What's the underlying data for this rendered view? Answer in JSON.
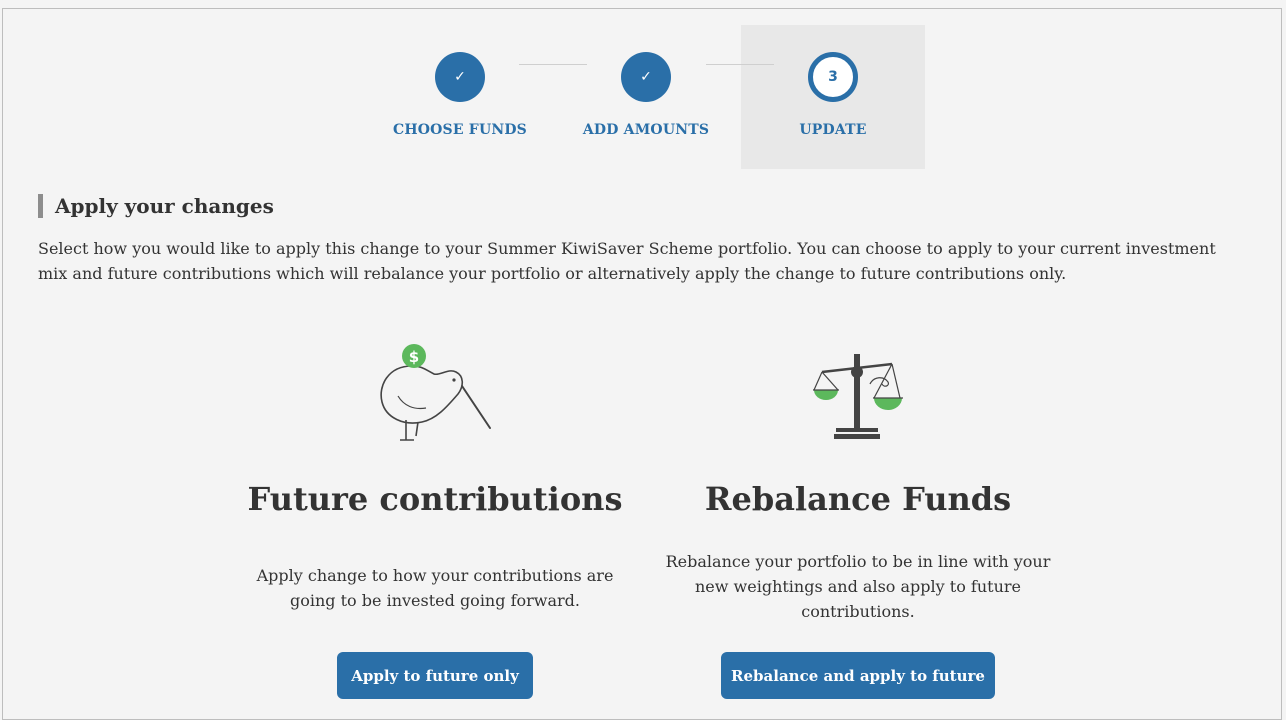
{
  "stepper": {
    "steps": [
      {
        "label": "CHOOSE FUNDS",
        "mark": "✓",
        "state": "complete"
      },
      {
        "label": "ADD AMOUNTS",
        "mark": "✓",
        "state": "complete"
      },
      {
        "label": "UPDATE",
        "mark": "3",
        "state": "current"
      }
    ]
  },
  "section": {
    "title": "Apply your changes",
    "intro": "Select how you would like to apply this change to your Summer KiwiSaver Scheme portfolio. You can choose to apply to your current investment mix and future contributions which will rebalance your portfolio or alternatively apply the change to future contributions only."
  },
  "options": {
    "future": {
      "icon": "kiwi-dollar-icon",
      "title": "Future contributions",
      "description": "Apply change to how your contributions are going to be invested going forward.",
      "button": "Apply to future only"
    },
    "rebalance": {
      "icon": "balance-scale-icon",
      "title": "Rebalance Funds",
      "description": "Rebalance your portfolio to be in line with your new weightings and also apply to future contributions.",
      "button": "Rebalance and apply to future"
    }
  },
  "colors": {
    "accent": "#2a6fa8",
    "green": "#5cb85c",
    "background": "#f4f4f4"
  }
}
